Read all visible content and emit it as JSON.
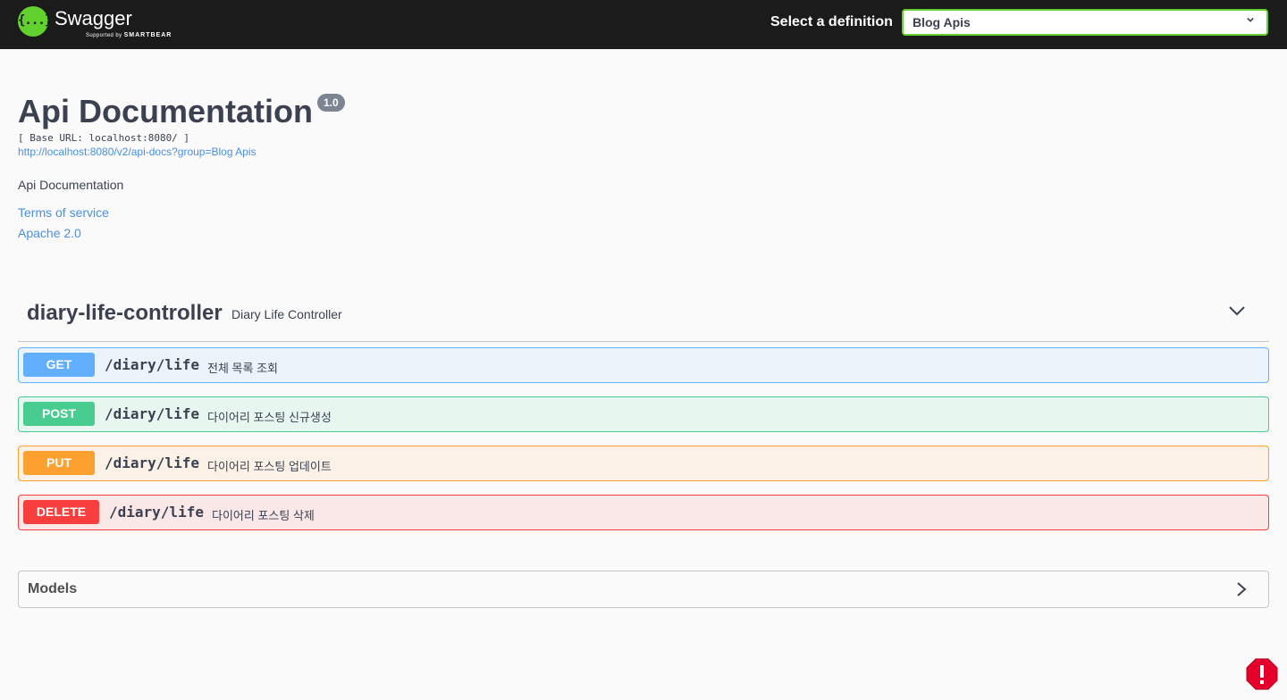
{
  "topbar": {
    "logo_title": "Swagger",
    "logo_sub_prefix": "Supported by",
    "logo_sub_brand": "SMARTBEAR",
    "logo_glyph": "{...}",
    "definition_label": "Select a definition",
    "definition_value": "Blog Apis"
  },
  "info": {
    "title": "Api Documentation",
    "version": "1.0",
    "base_url": "[ Base URL: localhost:8080/ ]",
    "docs_link": "http://localhost:8080/v2/api-docs?group=Blog Apis",
    "description": "Api Documentation",
    "terms": "Terms of service",
    "license": "Apache 2.0"
  },
  "controller": {
    "name": "diary-life-controller",
    "description": "Diary Life Controller",
    "operations": [
      {
        "method": "GET",
        "path": "/diary/life",
        "summary": "전체 목록 조회",
        "color": "#61affe"
      },
      {
        "method": "POST",
        "path": "/diary/life",
        "summary": "다이어리 포스팅 신규생성",
        "color": "#49cc90"
      },
      {
        "method": "PUT",
        "path": "/diary/life",
        "summary": "다이어리 포스팅 업데이트",
        "color": "#fca130"
      },
      {
        "method": "DELETE",
        "path": "/diary/life",
        "summary": "다이어리 포스팅 삭제",
        "color": "#f93e3e"
      }
    ]
  },
  "models": {
    "title": "Models"
  },
  "colors": {
    "brand_green": "#62d02d",
    "link": "#4990e2",
    "error": "#e4002b"
  }
}
